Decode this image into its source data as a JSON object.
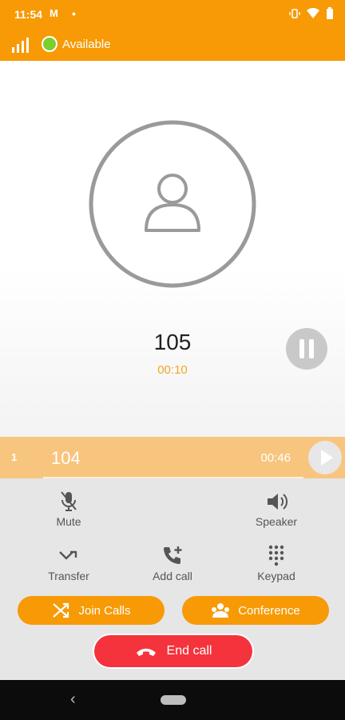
{
  "status_bar": {
    "time": "11:54",
    "notification": "M",
    "dot": "•"
  },
  "availability": {
    "status_label": "Available",
    "status_color": "#7ccf2f"
  },
  "active_call": {
    "number": "105",
    "duration": "00:10"
  },
  "held_call": {
    "index": "1",
    "number": "104",
    "duration": "00:46"
  },
  "controls": {
    "mute": "Mute",
    "speaker": "Speaker",
    "transfer": "Transfer",
    "add_call": "Add call",
    "keypad": "Keypad",
    "join_calls": "Join Calls",
    "conference": "Conference",
    "end_call": "End call"
  },
  "colors": {
    "accent": "#f79a05",
    "held_row": "#f8c57e",
    "end_call": "#f4333c",
    "timer": "#f5a623"
  },
  "icons": [
    "signal-icon",
    "avatar-icon",
    "pause-icon",
    "play-icon",
    "mute-icon",
    "speaker-icon",
    "transfer-icon",
    "add-call-icon",
    "keypad-icon",
    "join-calls-icon",
    "conference-icon",
    "end-call-icon"
  ]
}
